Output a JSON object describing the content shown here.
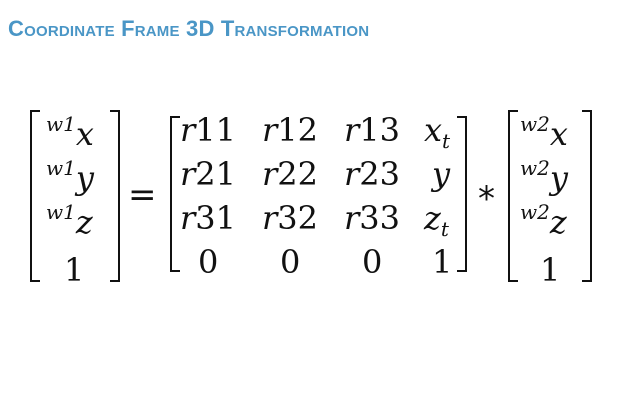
{
  "slide": {
    "title": "Coordinate Frame 3D Transformation"
  },
  "equation": {
    "lhs": {
      "entries": [
        {
          "pre": "w1",
          "var": "x"
        },
        {
          "pre": "w1",
          "var": "y"
        },
        {
          "pre": "w1",
          "var": "z"
        },
        {
          "pre": "",
          "var": "1"
        }
      ]
    },
    "equals": "=",
    "matrix": {
      "rows": [
        [
          {
            "t": "r11"
          },
          {
            "t": "r12"
          },
          {
            "t": "r13"
          },
          {
            "t": "x",
            "sub": "t"
          }
        ],
        [
          {
            "t": "r21"
          },
          {
            "t": "r22"
          },
          {
            "t": "r23"
          },
          {
            "t": "y"
          }
        ],
        [
          {
            "t": "r31"
          },
          {
            "t": "r32"
          },
          {
            "t": "r33"
          },
          {
            "t": "z",
            "sub": "t"
          }
        ],
        [
          {
            "t": "0"
          },
          {
            "t": "0"
          },
          {
            "t": "0"
          },
          {
            "t": "1"
          }
        ]
      ]
    },
    "times": "*",
    "rhs": {
      "entries": [
        {
          "pre": "w2",
          "var": "x"
        },
        {
          "pre": "w2",
          "var": "y"
        },
        {
          "pre": "w2",
          "var": "z"
        },
        {
          "pre": "",
          "var": "1"
        }
      ]
    }
  }
}
